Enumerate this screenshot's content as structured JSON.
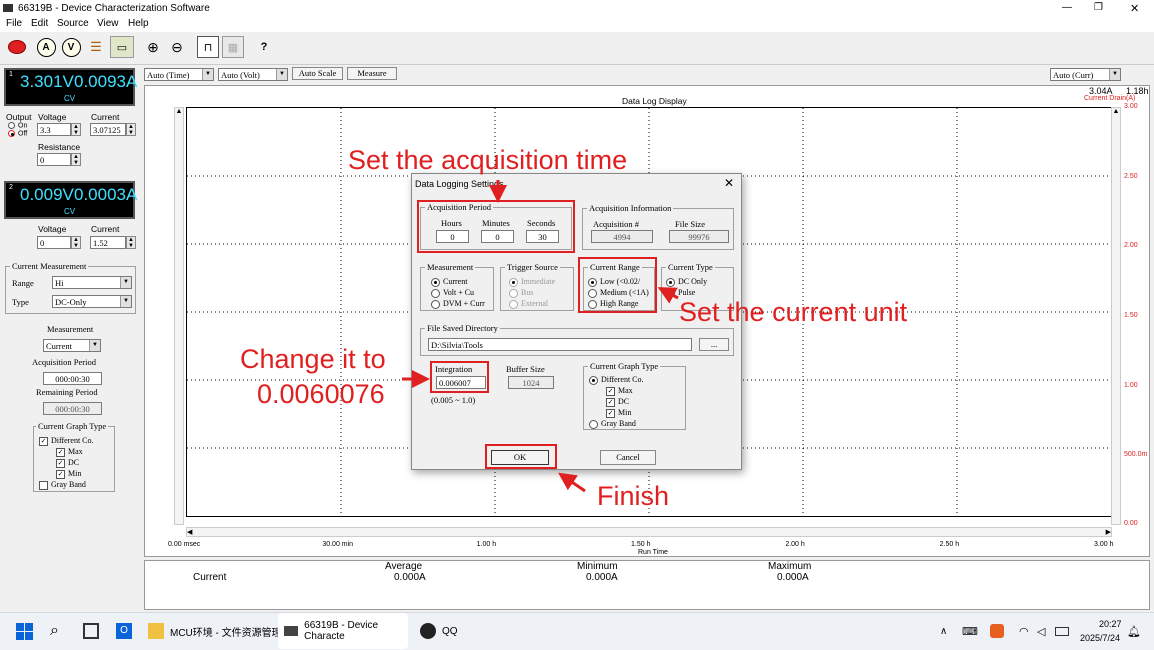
{
  "window": {
    "title": "66319B - Device Characterization Software",
    "controls": [
      "—",
      "❐",
      "✕"
    ]
  },
  "menu": [
    "File",
    "Edit",
    "Source",
    "View",
    "Help"
  ],
  "channel1": {
    "index": "1",
    "voltage": "3.301V",
    "current": "0.0093A",
    "mode": "CV"
  },
  "channel2": {
    "index": "2",
    "voltage": "0.009V",
    "current": "0.0003A",
    "mode": "CV"
  },
  "left_panel": {
    "output_label": "Output",
    "on_label": "On",
    "off_label": "Off",
    "voltage_label": "Voltage",
    "current_label": "Current",
    "resistance_label": "Resistance",
    "ch1_voltage": "3.3",
    "ch1_current": "3.07125",
    "resistance": "0",
    "ch2_voltage": "0",
    "ch2_current": "1.52",
    "current_measurement_title": "Current Measurement",
    "range_label": "Range",
    "range_value": "Hi",
    "type_label": "Type",
    "type_value": "DC-Only",
    "measurement_label": "Measurement",
    "measurement_value": "Current",
    "acq_period_label": "Acquisition Period",
    "acq_period_value": "000:00:30",
    "remaining_label": "Remaining Period",
    "remaining_value": "000:00:30",
    "graph_type_title": "Current Graph Type",
    "different_co": "Different Co.",
    "max": "Max",
    "dc": "DC",
    "min": "Min",
    "gray_band": "Gray Band"
  },
  "chart_toolbar": {
    "auto_time": "Auto (Time)",
    "auto_volt": "Auto (Volt)",
    "auto_scale": "Auto Scale",
    "measure": "Measure",
    "auto_curr": "Auto (Curr)"
  },
  "chart_data": {
    "type": "line",
    "title": "Data Log Display",
    "xlabel": "Run Time",
    "x_ticks": [
      "0.00 msec",
      "30.00 min",
      "1.00 h",
      "1.50 h",
      "2.00 h",
      "2.50 h",
      "3.00 h"
    ],
    "ylabel_right": "Current Drain(A)",
    "y_ticks_right": [
      "3.00",
      "2.50",
      "2.00",
      "1.50",
      "1.00",
      "500.0m",
      "0.00"
    ],
    "readout_current": "3.04A",
    "readout_time": "1.18h",
    "grid": true,
    "series": []
  },
  "stats": {
    "row_label": "Current",
    "average_label": "Average",
    "average_value": "0.000A",
    "minimum_label": "Minimum",
    "minimum_value": "0.000A",
    "maximum_label": "Maximum",
    "maximum_value": "0.000A"
  },
  "dialog": {
    "title": "Data Logging Settings",
    "acq_period_title": "Acquisition Period",
    "hours_label": "Hours",
    "minutes_label": "Minutes",
    "seconds_label": "Seconds",
    "hours": "0",
    "minutes": "0",
    "seconds": "30",
    "acq_info_title": "Acquisition Information",
    "acq_num_label": "Acquisition #",
    "file_size_label": "File Size",
    "acq_num": "4994",
    "file_size": "99976",
    "measurement_title": "Measurement",
    "meas_current": "Current",
    "meas_volt_cu": "Volt + Cu",
    "meas_dvm_curr": "DVM + Curr",
    "trigger_title": "Trigger Source",
    "trig_immediate": "Immediate",
    "trig_bus": "Bus",
    "trig_external": "External",
    "range_title": "Current Range",
    "range_low": "Low (<0.02/",
    "range_medium": "Medium (<1A)",
    "range_high": "High Range",
    "ctype_title": "Current Type",
    "ctype_dc": "DC Only",
    "ctype_pulse": "Pulse",
    "dir_title": "File Saved Directory",
    "dir_value": "D:\\Silvia\\Tools",
    "browse": "...",
    "integration_title": "Integration",
    "integration_value": "0.006007",
    "integration_range": "(0.005 ~ 1.0)",
    "buffer_title": "Buffer Size",
    "buffer_value": "1024",
    "graph_title": "Current Graph Type",
    "graph_diff": "Different Co.",
    "graph_max": "Max",
    "graph_dc": "DC",
    "graph_min": "Min",
    "graph_gray": "Gray Band",
    "ok": "OK",
    "cancel": "Cancel"
  },
  "annotations": {
    "set_time": "Set the acquisition time",
    "set_unit": "Set the current unit",
    "change_line1": "Change it to",
    "change_line2": "0.0060076",
    "finish": "Finish",
    "color": "#e02020"
  },
  "taskbar": {
    "explorer": "MCU环境 - 文件资源管理",
    "app": "66319B - Device Characte",
    "qq": "QQ",
    "time": "20:27",
    "date": "2025/7/24"
  }
}
